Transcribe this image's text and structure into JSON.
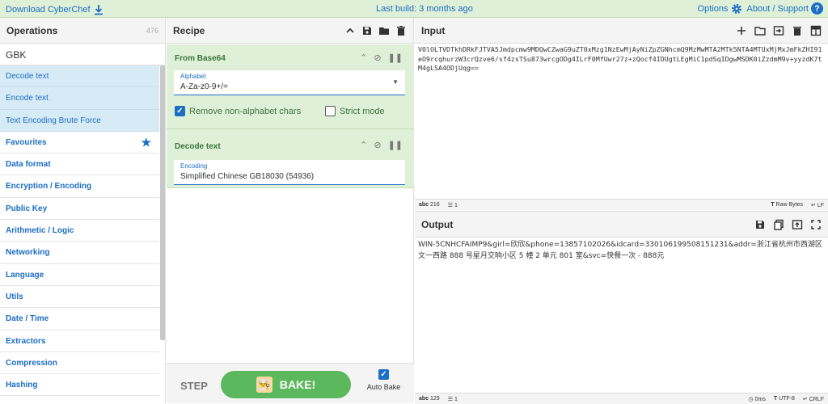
{
  "topbar": {
    "download": "Download CyberChef",
    "last_build": "Last build: 3 months ago",
    "options": "Options",
    "about": "About / Support",
    "about_icon": "?"
  },
  "operations": {
    "title": "Operations",
    "count": "476",
    "search_value": "GBK",
    "results": [
      "Decode text",
      "Encode text",
      "Text Encoding Brute Force"
    ],
    "categories": [
      "Favourites",
      "Data format",
      "Encryption / Encoding",
      "Public Key",
      "Arithmetic / Logic",
      "Networking",
      "Language",
      "Utils",
      "Date / Time",
      "Extractors",
      "Compression",
      "Hashing"
    ]
  },
  "recipe": {
    "title": "Recipe",
    "ingredients": [
      {
        "title": "From Base64",
        "field_label": "Alphabet",
        "field_value": "A-Za-z0-9+/=",
        "chk1": "Remove non-alphabet chars",
        "chk2": "Strict mode"
      },
      {
        "title": "Decode text",
        "field_label": "Encoding",
        "field_value": "Simplified Chinese GB18030 (54936)"
      }
    ],
    "step_label": "STEP",
    "bake_label": "BAKE!",
    "autobake_label": "Auto Bake"
  },
  "input": {
    "title": "Input",
    "text": "V0lOLTVDTkhDRkFJTVA5Jmdpcmw9MDQwCZwaG9uZT0xMzg1NzEwMjAyNiZpZGNhcmQ9MzMwMTA2MTk5NTA4MTUxMjMxJmFkZHI91eO9rcqhurzW3crQzve6/sf4zsTSu873wrcgODg4ILrF0MfUwr27z+zQocf4IDUgtLEgMiC1pdSqIDgwMSDK0iZzdmM9v+yyzdK7tM4gLSA4ODjUqg==",
    "status_chars": "216",
    "status_lines": "1",
    "status_font": "Raw Bytes",
    "status_eol": "LF"
  },
  "output": {
    "title": "Output",
    "text": "WIN-5CNHCFAIMP9&girl=欣欣&phone=13857102026&idcard=330106199508151231&addr=浙江省杭州市西湖区文一西路 888 号星月交响小区 5 幢 2 单元 801 室&svc=快餐一次 - 888元",
    "status_chars": "129",
    "status_lines": "1",
    "status_time": "0ms",
    "status_font": "UTF-8",
    "status_eol": "CRLF"
  }
}
